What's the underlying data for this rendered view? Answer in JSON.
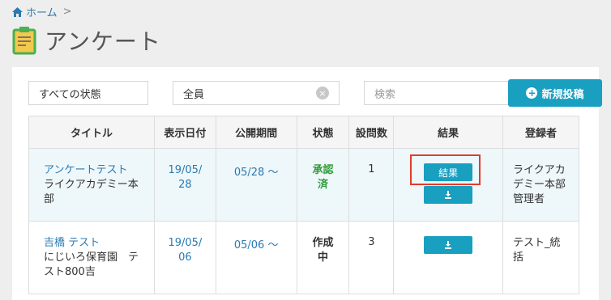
{
  "breadcrumb": {
    "home": "ホーム",
    "separator": ">"
  },
  "page": {
    "title": "アンケート"
  },
  "filters": {
    "status": "すべての状態",
    "user": "全員",
    "search_placeholder": "検索"
  },
  "actions": {
    "new_post": "新規投稿"
  },
  "table": {
    "headers": {
      "title": "タイトル",
      "date": "表示日付",
      "period": "公開期間",
      "status": "状態",
      "questions": "設問数",
      "result": "結果",
      "registrant": "登録者"
    },
    "rows": [
      {
        "title": "アンケートテスト",
        "subtitle": "ライクアカデミー本部",
        "date": "19/05/28",
        "period": "05/28 〜",
        "status": "承認済",
        "questions": "1",
        "result_label": "結果",
        "registrant": "ライクアカデミー本部管理者"
      },
      {
        "title": "吉橋 テスト",
        "subtitle": "にじいろ保育園　テスト800吉",
        "date": "19/05/06",
        "period": "05/06 〜",
        "status": "作成中",
        "questions": "3",
        "registrant": "テスト_統括"
      }
    ]
  },
  "colors": {
    "accent": "#199fc0",
    "link": "#2a7ab0",
    "approved": "#2f9c3a",
    "highlight": "#e23c2a"
  },
  "icons": [
    "home-icon",
    "clipboard-icon",
    "clear-icon",
    "plus-circle-icon",
    "download-icon"
  ]
}
